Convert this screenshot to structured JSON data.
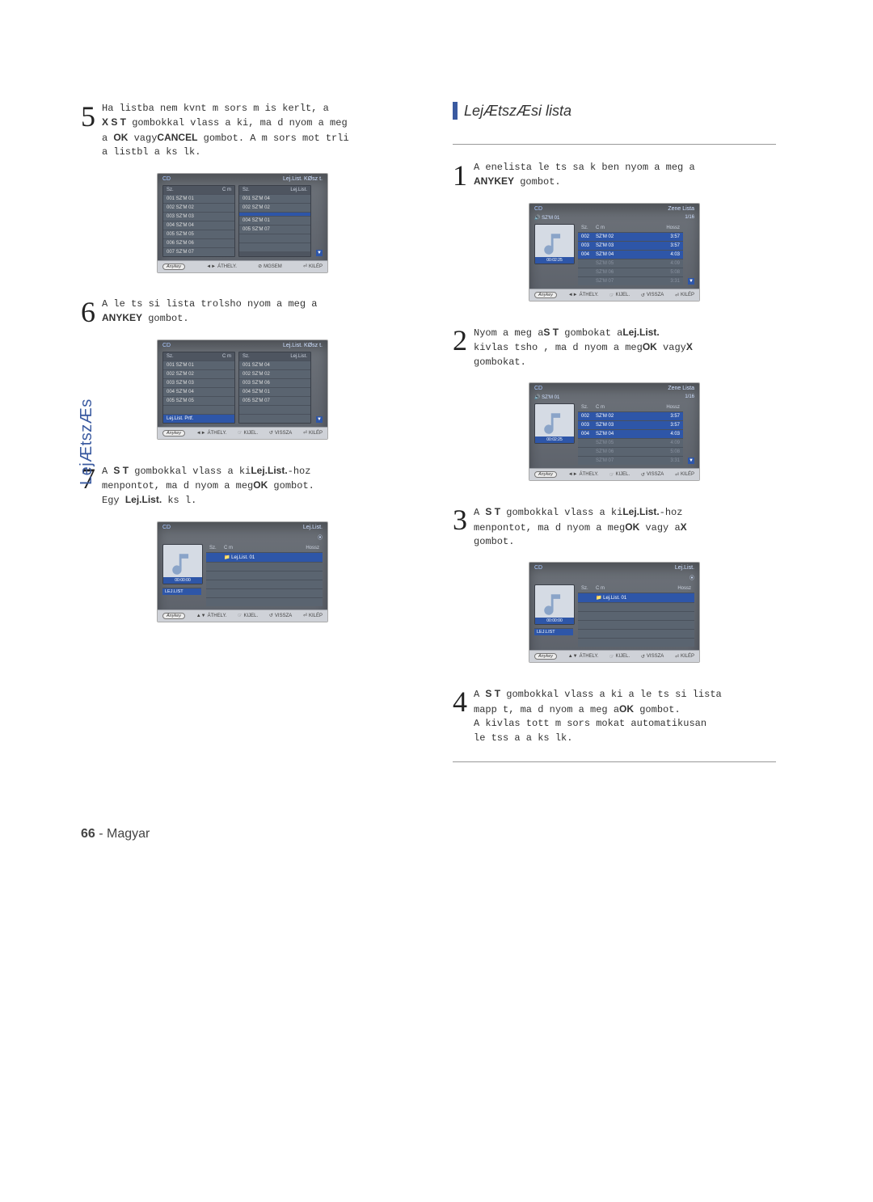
{
  "sidelabel": "LejÆtszÆs",
  "section_title": "LejÆtszÆsi lista",
  "leftcol": {
    "step5": {
      "num": "5",
      "line1_a": "Ha listba nem kvnt m sors m is kerlt, a",
      "line1_b_sans": "X S T",
      "line1_c": " gombokkal vlass a ki, ma d nyom a meg",
      "line2_a": "a ",
      "line2_ok": "OK",
      "line2_b": " vagy",
      "line2_cancel": "CANCEL",
      "line2_c": " gombot. A m sors mot trli",
      "line3": "a listbl a ks lk."
    },
    "step6": {
      "num": "6",
      "line1": "A le ts si lista trolsho  nyom a meg a",
      "anykey": "ANYKEY",
      "line2": " gombot."
    },
    "step7": {
      "num": "7",
      "line1_a": "A ",
      "line1_st": "S T",
      "line1_b": " gombokkal vlass a ki",
      "line1_lej": "Lej.List.",
      "line1_c": "-hoz",
      "line2_a": "menpontot, ma d nyom a meg",
      "line2_ok": "OK",
      "line2_b": " gombot.",
      "line3_a": "Egy  ",
      "line3_lej": "Lej.List.",
      "line3_b": "  ks l."
    }
  },
  "rightcol": {
    "step1": {
      "num": "1",
      "line1": "A  enelista le ts sa k ben nyom a meg a",
      "anykey": "ANYKEY",
      "line2": " gombot."
    },
    "step2": {
      "num": "2",
      "line1_a": "Nyom a meg a",
      "line1_st": "S T",
      "line1_b": " gombokat a",
      "line1_lej": "Lej.List.",
      "line2_a": "kivlas tsho , ma d nyom a meg",
      "line2_ok": "OK",
      "line2_b": " vagy",
      "line2_x": "X",
      "line3": "gombokat."
    },
    "step3": {
      "num": "3",
      "line1_a": "A ",
      "line1_st": "S T",
      "line1_b": " gombokkal vlass a ki",
      "line1_lej": "Lej.List.",
      "line1_c": "-hoz",
      "line2_a": "menpontot, ma d nyom a meg",
      "line2_ok": "OK",
      "line2_b": " vagy a",
      "line2_x": "X",
      "line3": "gombot."
    },
    "step4": {
      "num": "4",
      "line1_a": "A ",
      "line1_st": "S T",
      "line1_b": " gombokkal vlass a ki a le ts si lista",
      "line2_a": "mapp t, ma d nyom a meg a",
      "line2_ok": "OK",
      "line2_b": " gombot.",
      "line3": "A kivlas tott m sors mokat automatikusan",
      "line4": "le tss a a ks lk."
    }
  },
  "shots": {
    "common_footer": {
      "anykey": "Anykey",
      "thely": "ÁTHELY.",
      "mgsem": "MGSEM",
      "kilp": "KILÉP",
      "kijel": "KIJEL.",
      "vissza": "VISSZA"
    },
    "cd_label": "CD",
    "dual": {
      "title_right": "Lej.List. KØsz t.",
      "hdr_left_no": "Sz.",
      "hdr_left_cm": "C m",
      "hdr_right_no": "Sz.",
      "hdr_right_lej": "Lej.List.",
      "left_rows": [
        "001  SZ'M 01",
        "002  SZ'M 02",
        "003  SZ'M 03",
        "004  SZ'M 04",
        "005  SZ'M 05",
        "006  SZ'M 06",
        "007  SZ'M 07"
      ],
      "right_rows": [
        "001  SZ'M 04",
        "002  SZ'M 02",
        "",
        "004  SZ'M 01",
        "005  SZ'M 07",
        "",
        ""
      ]
    },
    "dual2": {
      "left_rows": [
        "001  SZ'M 01",
        "002  SZ'M 02",
        "003  SZ'M 03",
        "004  SZ'M 04",
        "005  SZ'M 05",
        "",
        ""
      ],
      "left_hilite": "Lej.List. Prtf.",
      "right_rows": [
        "001  SZ'M 04",
        "002  SZ'M 02",
        "003  SZ'M 06",
        "004  SZ'M 01",
        "005  SZ'M 07",
        "",
        ""
      ]
    },
    "playlist_single": {
      "title_right": "Lej.List.",
      "pb_time": "00:00:00",
      "side_label": "LEJ.LIST",
      "hdr_no": "Sz.",
      "hdr_cm": "C m",
      "hdr_len": "Hossz",
      "row_label": "Lej.List. 01"
    },
    "zenelista": {
      "title_right": "Zene Lista",
      "counter": "1/16",
      "now_playing": "SZ'M 01",
      "pb_time": "00:02:25",
      "hdr_no": "Sz.",
      "hdr_cm": "C m",
      "hdr_len": "Hossz",
      "rows": [
        {
          "no": "002",
          "cm": "SZ'M 02",
          "len": "3:57"
        },
        {
          "no": "003",
          "cm": "SZ'M 03",
          "len": "3:57"
        },
        {
          "no": "004",
          "cm": "SZ'M 04",
          "len": "4:03"
        },
        {
          "no": "",
          "cm": "SZ'M 05",
          "len": "4:09"
        },
        {
          "no": "",
          "cm": "SZ'M 06",
          "len": "5:08"
        },
        {
          "no": "",
          "cm": "SZ'M 07",
          "len": "3:31"
        }
      ]
    }
  },
  "pagenum": {
    "n": "66",
    "dash": " - ",
    "lang": "Magyar"
  }
}
